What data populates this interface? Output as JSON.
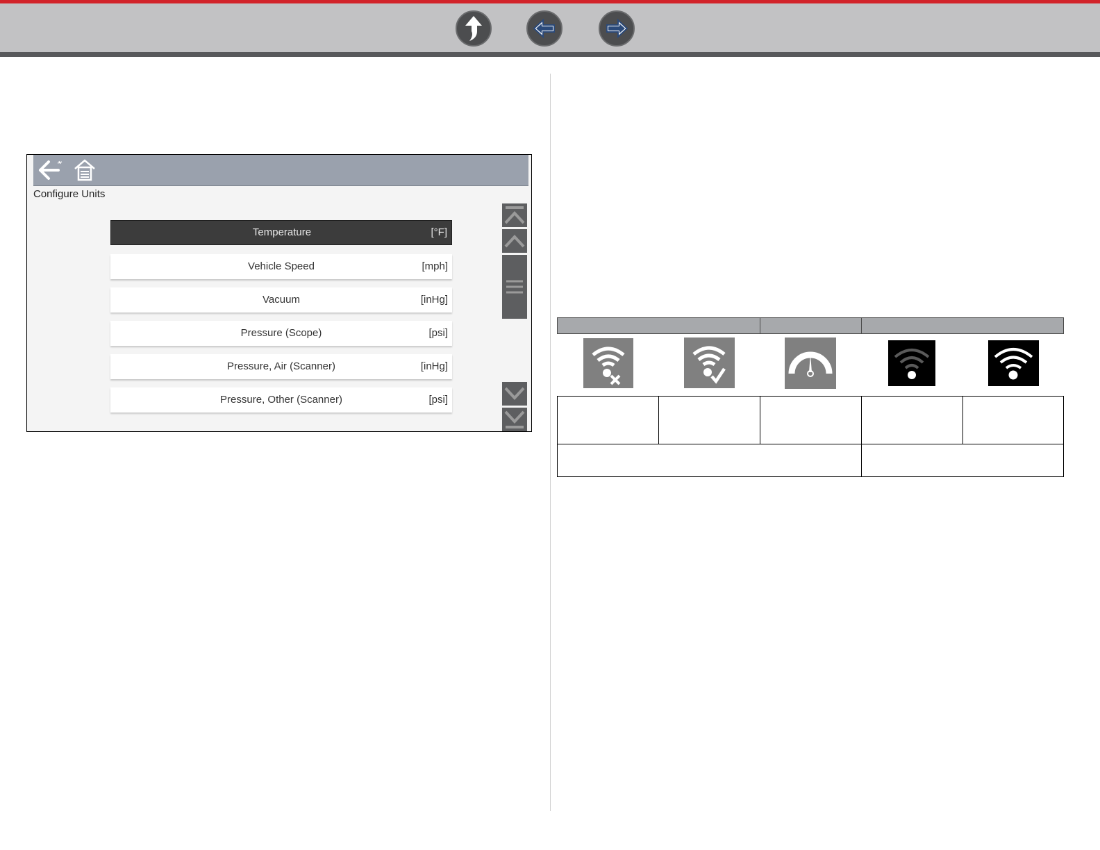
{
  "nav": {
    "buttons": [
      {
        "name": "up-icon"
      },
      {
        "name": "back-arrow-icon"
      },
      {
        "name": "forward-arrow-icon"
      }
    ]
  },
  "screen": {
    "title": "Configure Units",
    "header_icons": [
      "back-icon",
      "home-icon"
    ],
    "items": [
      {
        "label": "Temperature",
        "unit": "[°F]",
        "selected": true
      },
      {
        "label": "Vehicle Speed",
        "unit": "[mph]",
        "selected": false
      },
      {
        "label": "Vacuum",
        "unit": "[inHg]",
        "selected": false
      },
      {
        "label": "Pressure (Scope)",
        "unit": "[psi]",
        "selected": false
      },
      {
        "label": "Pressure, Air (Scanner)",
        "unit": "[inHg]",
        "selected": false
      },
      {
        "label": "Pressure, Other (Scanner)",
        "unit": "[psi]",
        "selected": false
      }
    ],
    "scroll_icons": [
      "scroll-top-icon",
      "scroll-up-icon",
      "scroll-thumb-icon",
      "scroll-down-icon",
      "scroll-bottom-icon"
    ]
  },
  "status_table": {
    "icons": [
      "wifi-disconnected-icon",
      "wifi-connected-icon",
      "gauge-icon",
      "wifi-weak-signal-icon",
      "wifi-strong-signal-icon"
    ],
    "colors": {
      "header": "#a7a9ac",
      "icon_gray": "#808080",
      "icon_black": "#000000"
    }
  }
}
